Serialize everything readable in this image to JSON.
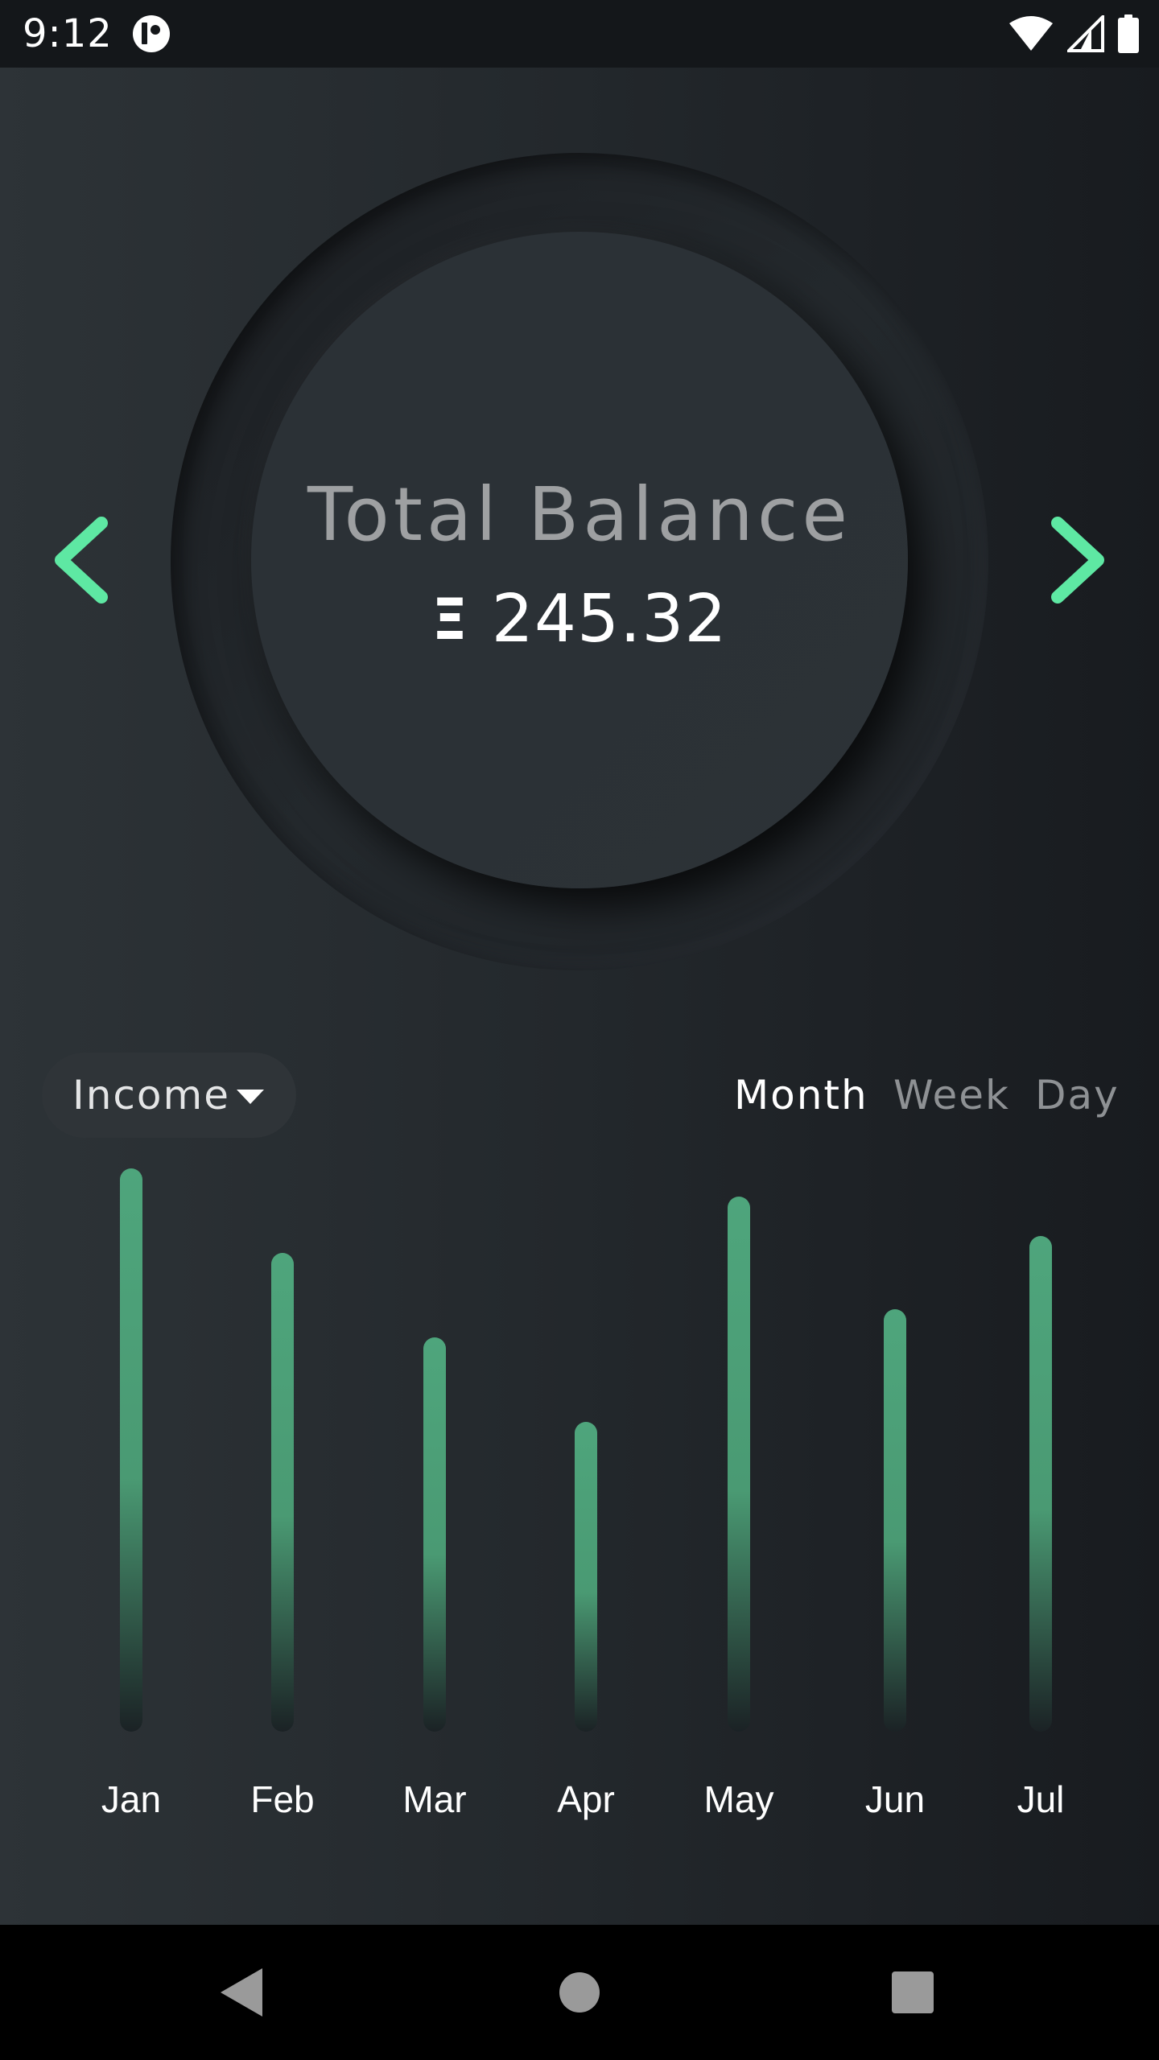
{
  "status_bar": {
    "time": "9:12",
    "icons": [
      "app-notification-icon",
      "wifi-icon",
      "cellular-signal-icon",
      "battery-icon"
    ]
  },
  "balance": {
    "title": "Total Balance",
    "currency_symbol": "Ξ",
    "amount": "245.32",
    "prev_icon": "chevron-left-icon",
    "next_icon": "chevron-right-icon",
    "arrow_color": "#5ee8a3"
  },
  "filter": {
    "dropdown_label": "Income",
    "dropdown_icon": "caret-down-icon",
    "tabs": [
      {
        "label": "Month",
        "active": true
      },
      {
        "label": "Week",
        "active": false
      },
      {
        "label": "Day",
        "active": false
      }
    ]
  },
  "chart_data": {
    "type": "bar",
    "categories": [
      "Jan",
      "Feb",
      "Mar",
      "Apr",
      "May",
      "Jun",
      "Jul"
    ],
    "values": [
      100,
      85,
      70,
      55,
      95,
      75,
      88
    ],
    "bar_color": "#4ea57c",
    "label_color": "#ffffff"
  },
  "nav_bar": {
    "buttons": [
      "back-icon",
      "home-icon",
      "recent-apps-icon"
    ]
  }
}
